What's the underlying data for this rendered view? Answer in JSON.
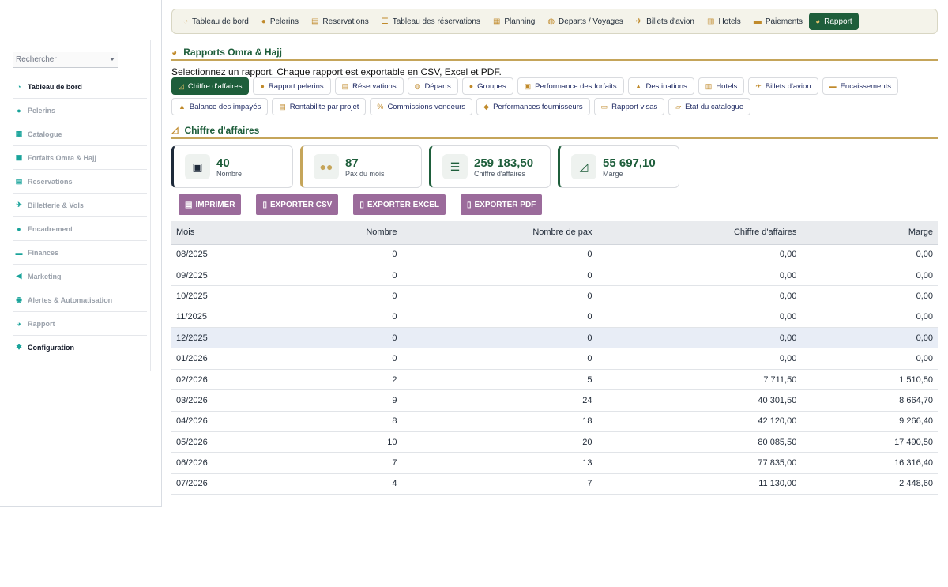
{
  "sidebar": {
    "search_placeholder": "Rechercher",
    "items": [
      {
        "label": "Tableau de bord",
        "icon": "dashboard-icon",
        "glyph": "◔",
        "dark": true
      },
      {
        "label": "Pelerins",
        "icon": "user-icon",
        "glyph": "●",
        "dark": false
      },
      {
        "label": "Catalogue",
        "icon": "catalogue-icon",
        "glyph": "▦",
        "dark": false
      },
      {
        "label": "Forfaits Omra & Hajj",
        "icon": "package-icon",
        "glyph": "▣",
        "dark": false
      },
      {
        "label": "Reservations",
        "icon": "clipboard-icon",
        "glyph": "▤",
        "dark": false
      },
      {
        "label": "Billetterie & Vols",
        "icon": "plane-icon",
        "glyph": "✈",
        "dark": false
      },
      {
        "label": "Encadrement",
        "icon": "guide-icon",
        "glyph": "●",
        "dark": false
      },
      {
        "label": "Finances",
        "icon": "money-icon",
        "glyph": "▬",
        "dark": false
      },
      {
        "label": "Marketing",
        "icon": "megaphone-icon",
        "glyph": "◀",
        "dark": false
      },
      {
        "label": "Alertes & Automatisation",
        "icon": "robot-icon",
        "glyph": "◉",
        "dark": false
      },
      {
        "label": "Rapport",
        "icon": "chart-pie-icon",
        "glyph": "◕",
        "dark": false
      },
      {
        "label": "Configuration",
        "icon": "gear-icon",
        "glyph": "✱",
        "dark": true
      }
    ]
  },
  "topnav": {
    "items": [
      {
        "label": "Tableau de bord",
        "icon": "dashboard-icon",
        "glyph": "◔",
        "active": false
      },
      {
        "label": "Pelerins",
        "icon": "user-icon",
        "glyph": "●",
        "active": false
      },
      {
        "label": "Reservations",
        "icon": "clipboard-icon",
        "glyph": "▤",
        "active": false
      },
      {
        "label": "Tableau des réservations",
        "icon": "list-icon",
        "glyph": "☰",
        "active": false
      },
      {
        "label": "Planning",
        "icon": "calendar-icon",
        "glyph": "▦",
        "active": false
      },
      {
        "label": "Departs / Voyages",
        "icon": "globe-icon",
        "glyph": "◍",
        "active": false
      },
      {
        "label": "Billets d'avion",
        "icon": "plane-icon",
        "glyph": "✈",
        "active": false
      },
      {
        "label": "Hotels",
        "icon": "hotel-icon",
        "glyph": "▥",
        "active": false
      },
      {
        "label": "Paiements",
        "icon": "money-icon",
        "glyph": "▬",
        "active": false
      },
      {
        "label": "Rapport",
        "icon": "chart-pie-icon",
        "glyph": "◕",
        "active": true
      }
    ]
  },
  "page": {
    "title": "Rapports Omra & Hajj",
    "intro": "Selectionnez un rapport. Chaque rapport est exportable en CSV, Excel et PDF.",
    "subtitle": "Chiffre d'affaires"
  },
  "reports": [
    {
      "label": "Chiffre d'affaires",
      "icon": "line-chart-icon",
      "glyph": "◿",
      "active": true
    },
    {
      "label": "Rapport pelerins",
      "icon": "user-icon",
      "glyph": "●",
      "active": false
    },
    {
      "label": "Réservations",
      "icon": "clipboard-icon",
      "glyph": "▤",
      "active": false
    },
    {
      "label": "Départs",
      "icon": "globe-icon",
      "glyph": "◍",
      "active": false
    },
    {
      "label": "Groupes",
      "icon": "users-icon",
      "glyph": "●",
      "active": false
    },
    {
      "label": "Performance des forfaits",
      "icon": "package-icon",
      "glyph": "▣",
      "active": false
    },
    {
      "label": "Destinations",
      "icon": "map-icon",
      "glyph": "▲",
      "active": false
    },
    {
      "label": "Hotels",
      "icon": "hotel-icon",
      "glyph": "▥",
      "active": false
    },
    {
      "label": "Billets d'avion",
      "icon": "plane-icon",
      "glyph": "✈",
      "active": false
    },
    {
      "label": "Encaissements",
      "icon": "money-icon",
      "glyph": "▬",
      "active": false
    },
    {
      "label": "Balance des impayés",
      "icon": "warning-icon",
      "glyph": "▲",
      "active": false
    },
    {
      "label": "Rentabilite par projet",
      "icon": "coins-icon",
      "glyph": "▤",
      "active": false
    },
    {
      "label": "Commissions vendeurs",
      "icon": "percent-icon",
      "glyph": "%",
      "active": false
    },
    {
      "label": "Performances fournisseurs",
      "icon": "handshake-icon",
      "glyph": "◆",
      "active": false
    },
    {
      "label": "Rapport visas",
      "icon": "passport-icon",
      "glyph": "▭",
      "active": false
    },
    {
      "label": "État du catalogue",
      "icon": "folder-icon",
      "glyph": "▱",
      "active": false
    }
  ],
  "kpis": [
    {
      "value": "40",
      "label": "Nombre",
      "icon": "clipboard-check-icon",
      "glyph": "▣"
    },
    {
      "value": "87",
      "label": "Pax du mois",
      "icon": "users-icon",
      "glyph": "●●"
    },
    {
      "value": "259 183,50",
      "label": "Chiffre d'affaires",
      "icon": "coins-icon",
      "glyph": "☰"
    },
    {
      "value": "55 697,10",
      "label": "Marge",
      "icon": "line-chart-icon",
      "glyph": "◿"
    }
  ],
  "exports": [
    {
      "label": "IMPRIMER",
      "icon": "printer-icon",
      "glyph": "▤"
    },
    {
      "label": "EXPORTER CSV",
      "icon": "file-icon",
      "glyph": "▯"
    },
    {
      "label": "EXPORTER EXCEL",
      "icon": "file-excel-icon",
      "glyph": "▯"
    },
    {
      "label": "EXPORTER PDF",
      "icon": "file-pdf-icon",
      "glyph": "▯"
    }
  ],
  "table": {
    "headers": [
      "Mois",
      "Nombre",
      "Nombre de pax",
      "Chiffre d'affaires",
      "Marge"
    ],
    "rows": [
      [
        "08/2025",
        "0",
        "0",
        "0,00",
        "0,00"
      ],
      [
        "09/2025",
        "0",
        "0",
        "0,00",
        "0,00"
      ],
      [
        "10/2025",
        "0",
        "0",
        "0,00",
        "0,00"
      ],
      [
        "11/2025",
        "0",
        "0",
        "0,00",
        "0,00"
      ],
      [
        "12/2025",
        "0",
        "0",
        "0,00",
        "0,00"
      ],
      [
        "01/2026",
        "0",
        "0",
        "0,00",
        "0,00"
      ],
      [
        "02/2026",
        "2",
        "5",
        "7 711,50",
        "1 510,50"
      ],
      [
        "03/2026",
        "9",
        "24",
        "40 301,50",
        "8 664,70"
      ],
      [
        "04/2026",
        "8",
        "18",
        "42 120,00",
        "9 266,40"
      ],
      [
        "05/2026",
        "10",
        "20",
        "80 085,50",
        "17 490,50"
      ],
      [
        "06/2026",
        "7",
        "13",
        "77 835,00",
        "16 316,40"
      ],
      [
        "07/2026",
        "4",
        "7",
        "11 130,00",
        "2 448,60"
      ]
    ],
    "highlight_row": 4
  }
}
